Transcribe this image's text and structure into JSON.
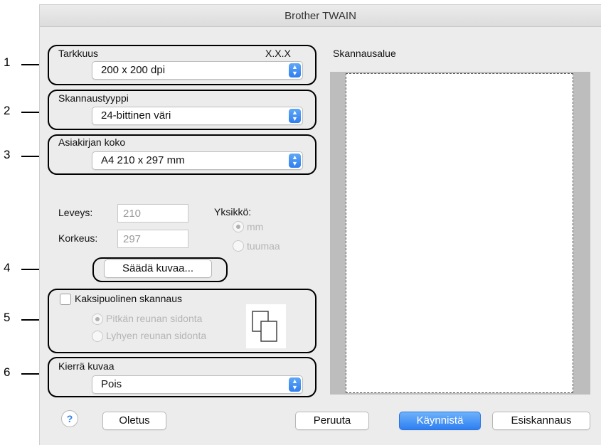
{
  "window": {
    "title": "Brother TWAIN"
  },
  "callouts": [
    "1",
    "2",
    "3",
    "4",
    "5",
    "6"
  ],
  "resolution": {
    "label": "Tarkkuus",
    "version": "X.X.X",
    "value": "200 x 200 dpi"
  },
  "scan_type": {
    "label": "Skannaustyyppi",
    "value": "24-bittinen väri"
  },
  "document_size": {
    "label": "Asiakirjan koko",
    "value": "A4  210 x 297 mm"
  },
  "dimensions": {
    "width_label": "Leveys:",
    "width_value": "210",
    "height_label": "Korkeus:",
    "height_value": "297",
    "unit_label": "Yksikkö:",
    "unit_options": [
      "mm",
      "tuumaa"
    ],
    "unit_selected": "mm"
  },
  "adjust_image_label": "Säädä kuvaa...",
  "duplex": {
    "label": "Kaksipuolinen skannaus",
    "checked": false,
    "options": [
      "Pitkän reunan sidonta",
      "Lyhyen reunan sidonta"
    ],
    "selected": "Pitkän reunan sidonta"
  },
  "rotate": {
    "label": "Kierrä kuvaa",
    "value": "Pois"
  },
  "scan_area": {
    "label": "Skannausalue"
  },
  "buttons": {
    "help": "?",
    "default": "Oletus",
    "cancel": "Peruuta",
    "start": "Käynnistä",
    "prescan": "Esiskannaus"
  },
  "colors": {
    "accent": "#2e7ff2",
    "window_bg": "#ececec",
    "scan_area_bg": "#bdbdbd"
  }
}
